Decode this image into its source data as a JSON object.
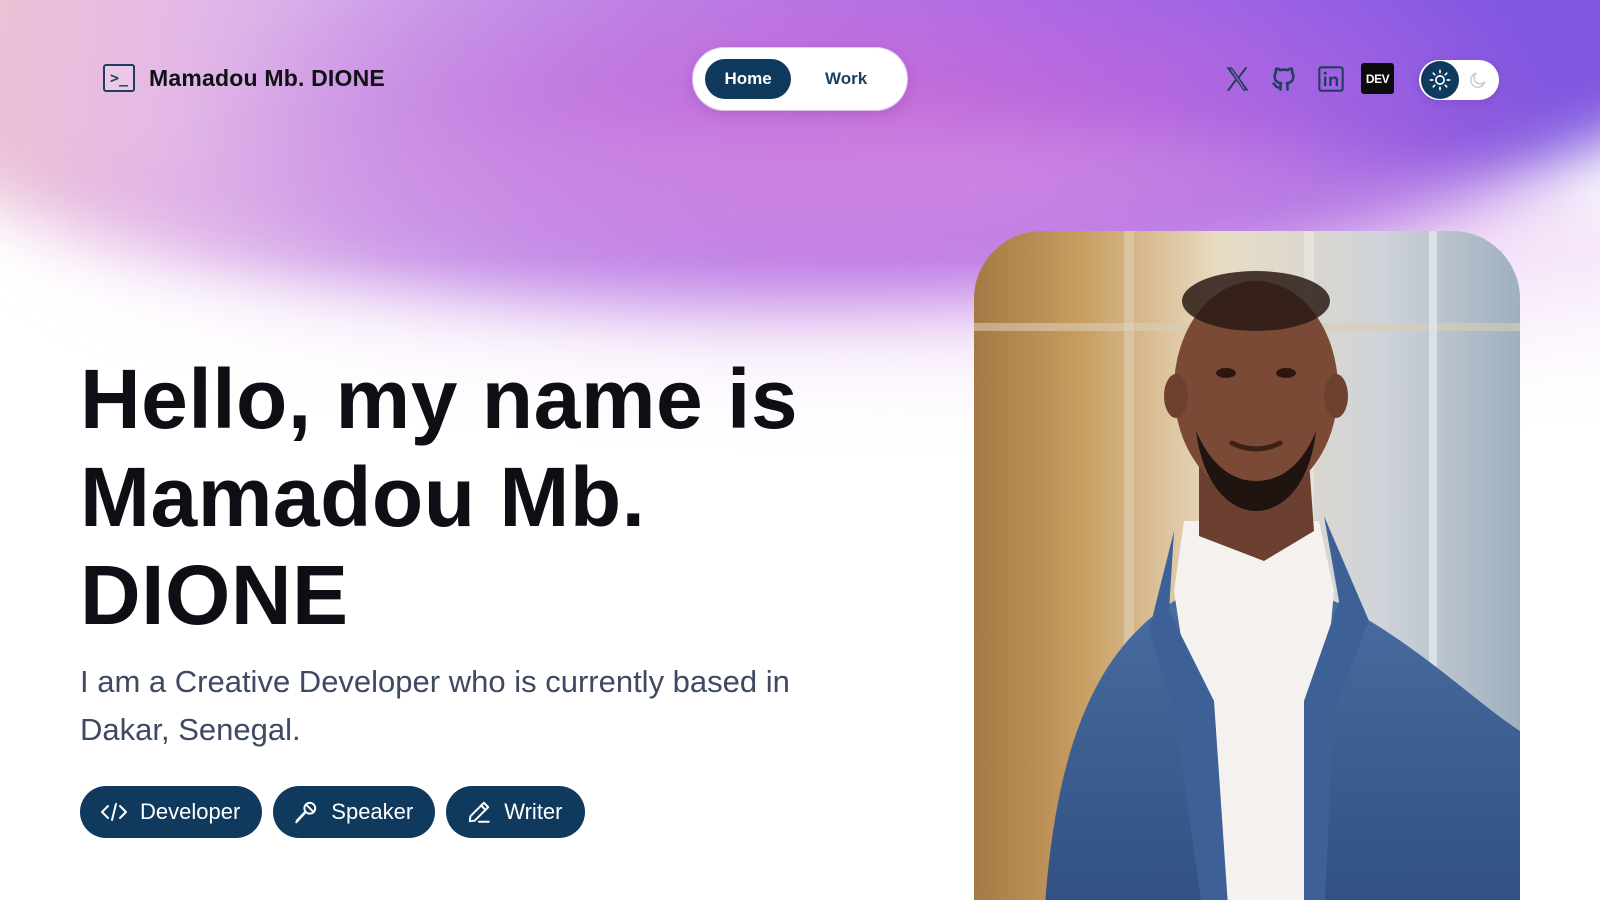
{
  "header": {
    "brand_name": "Mamadou Mb. DIONE",
    "nav": [
      {
        "label": "Home",
        "active": true
      },
      {
        "label": "Work",
        "active": false
      }
    ],
    "socials": [
      {
        "icon": "x-icon"
      },
      {
        "icon": "github-icon"
      },
      {
        "icon": "linkedin-icon"
      },
      {
        "icon": "dev-icon",
        "label": "DEV"
      }
    ],
    "theme_toggle": {
      "selected": "light"
    }
  },
  "hero": {
    "title_line1": "Hello, my name is",
    "title_line2": "Mamadou Mb.",
    "title_line3": "DIONE",
    "subtitle": "I am a Creative Developer who is currently based in Dakar, Senegal.",
    "tags": [
      {
        "label": "Developer",
        "icon": "code-icon"
      },
      {
        "label": "Speaker",
        "icon": "microphone-icon"
      },
      {
        "label": "Writer",
        "icon": "pencil-icon"
      }
    ]
  },
  "colors": {
    "primary": "#10395e",
    "text": "#0d0f14",
    "subtext": "#3d4a62"
  }
}
